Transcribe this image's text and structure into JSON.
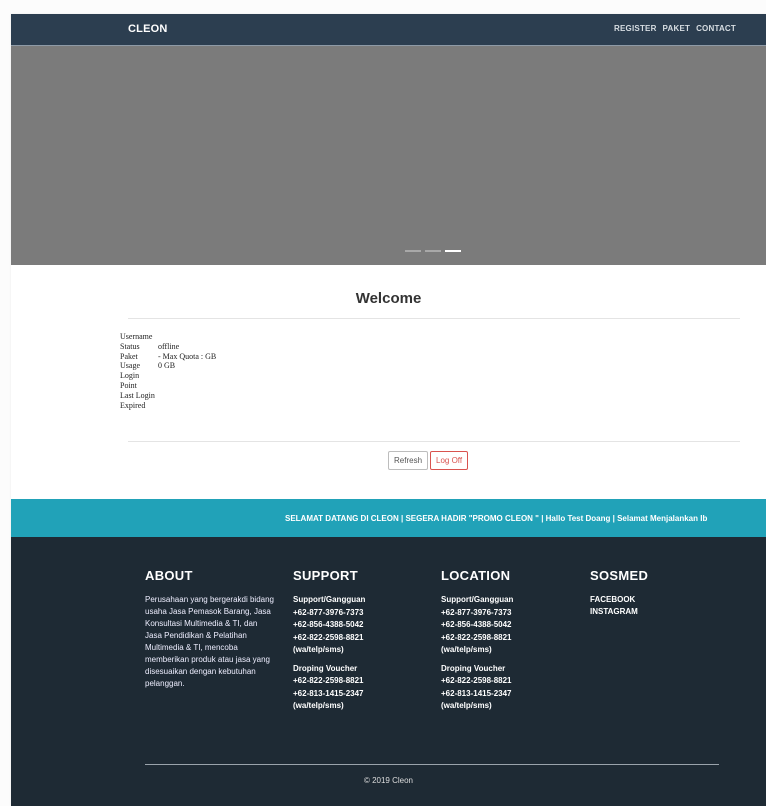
{
  "navbar": {
    "brand": "CLEON",
    "links": [
      "REGISTER",
      "PAKET",
      "CONTACT"
    ]
  },
  "welcome": {
    "title": "Welcome",
    "fields": [
      {
        "label": "Username",
        "value": ""
      },
      {
        "label": "Status",
        "value": "offline"
      },
      {
        "label": "Paket",
        "value": "- Max Quota : GB"
      },
      {
        "label": "Usage",
        "value": "0 GB"
      },
      {
        "label": "Login",
        "value": ""
      },
      {
        "label": "Point",
        "value": ""
      },
      {
        "label": "Last Login",
        "value": ""
      },
      {
        "label": "Expired",
        "value": ""
      }
    ],
    "refresh_label": "Refresh",
    "logoff_label": "Log Off"
  },
  "marquee": {
    "text": "SELAMAT DATANG DI CLEON | SEGERA HADIR \"PROMO CLEON \" | Hallo Test Doang | Selamat Menjalankan Ib"
  },
  "footer": {
    "about": {
      "title": "ABOUT",
      "text": "Perusahaan yang bergerakdi bidang usaha Jasa Pemasok Barang, Jasa Konsultasi Multimedia & TI, dan Jasa Pendidikan & Pelatihan Multimedia & TI, mencoba memberikan produk atau jasa yang disesuaikan dengan kebutuhan pelanggan."
    },
    "support": {
      "title": "SUPPORT",
      "g1": [
        "Support/Gangguan",
        "+62-877-3976-7373",
        "+62-856-4388-5042",
        "+62-822-2598-8821",
        "(wa/telp/sms)"
      ],
      "g2": [
        "Droping Voucher",
        "+62-822-2598-8821",
        "+62-813-1415-2347",
        "(wa/telp/sms)"
      ]
    },
    "location": {
      "title": "LOCATION",
      "g1": [
        "Support/Gangguan",
        "+62-877-3976-7373",
        "+62-856-4388-5042",
        "+62-822-2598-8821",
        "(wa/telp/sms)"
      ],
      "g2": [
        "Droping Voucher",
        "+62-822-2598-8821",
        "+62-813-1415-2347",
        "(wa/telp/sms)"
      ]
    },
    "sosmed": {
      "title": "SOSMED",
      "links": [
        "FACEBOOK",
        "INSTAGRAM"
      ]
    },
    "copyright": "© 2019 Cleon"
  },
  "colors": {
    "navbar": "#2c3e50",
    "marquee": "#21a2b8",
    "footer": "#1e2a34",
    "logoff": "#d9534f"
  },
  "carousel": {
    "slide_count": 3,
    "active_index": 2
  }
}
